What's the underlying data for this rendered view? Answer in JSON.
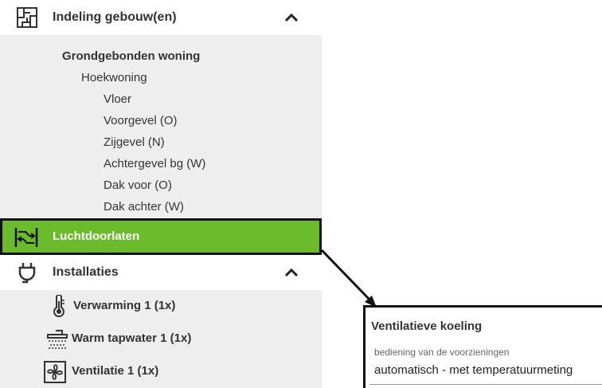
{
  "sidebar": {
    "building_section": {
      "label": "Indeling gebouw(en)",
      "icon": "floorplan-icon",
      "chevron": "chevron-up-icon"
    },
    "tree": [
      {
        "label": "Grondgebonden woning",
        "level": 0,
        "bold": true
      },
      {
        "label": "Hoekwoning",
        "level": 1,
        "bold": false
      },
      {
        "label": "Vloer",
        "level": 2,
        "bold": false
      },
      {
        "label": "Voorgevel (O)",
        "level": 2,
        "bold": false
      },
      {
        "label": "Zijgevel (N)",
        "level": 2,
        "bold": false
      },
      {
        "label": "Achtergevel bg (W)",
        "level": 2,
        "bold": false
      },
      {
        "label": "Dak voor (O)",
        "level": 2,
        "bold": false
      },
      {
        "label": "Dak achter (W)",
        "level": 2,
        "bold": false
      }
    ],
    "active_item": {
      "label": "Luchtdoorlaten",
      "icon": "air-flow-icon"
    },
    "installations_section": {
      "label": "Installaties",
      "icon": "plug-icon",
      "chevron": "chevron-up-icon"
    },
    "installations": [
      {
        "label": "Verwarming 1 (1x)",
        "icon": "thermometer-icon"
      },
      {
        "label": "Warm tapwater 1 (1x)",
        "icon": "shower-icon"
      },
      {
        "label": "Ventilatie 1 (1x)",
        "icon": "fan-icon"
      }
    ]
  },
  "detail": {
    "title": "Ventilatieve koeling",
    "field_label": "bediening van de voorzieningen",
    "field_value": "automatisch - met temperatuurmeting"
  },
  "colors": {
    "active_bg": "#6cbb2c",
    "tree_bg": "#eeeeee",
    "highlight_border": "#111111"
  }
}
